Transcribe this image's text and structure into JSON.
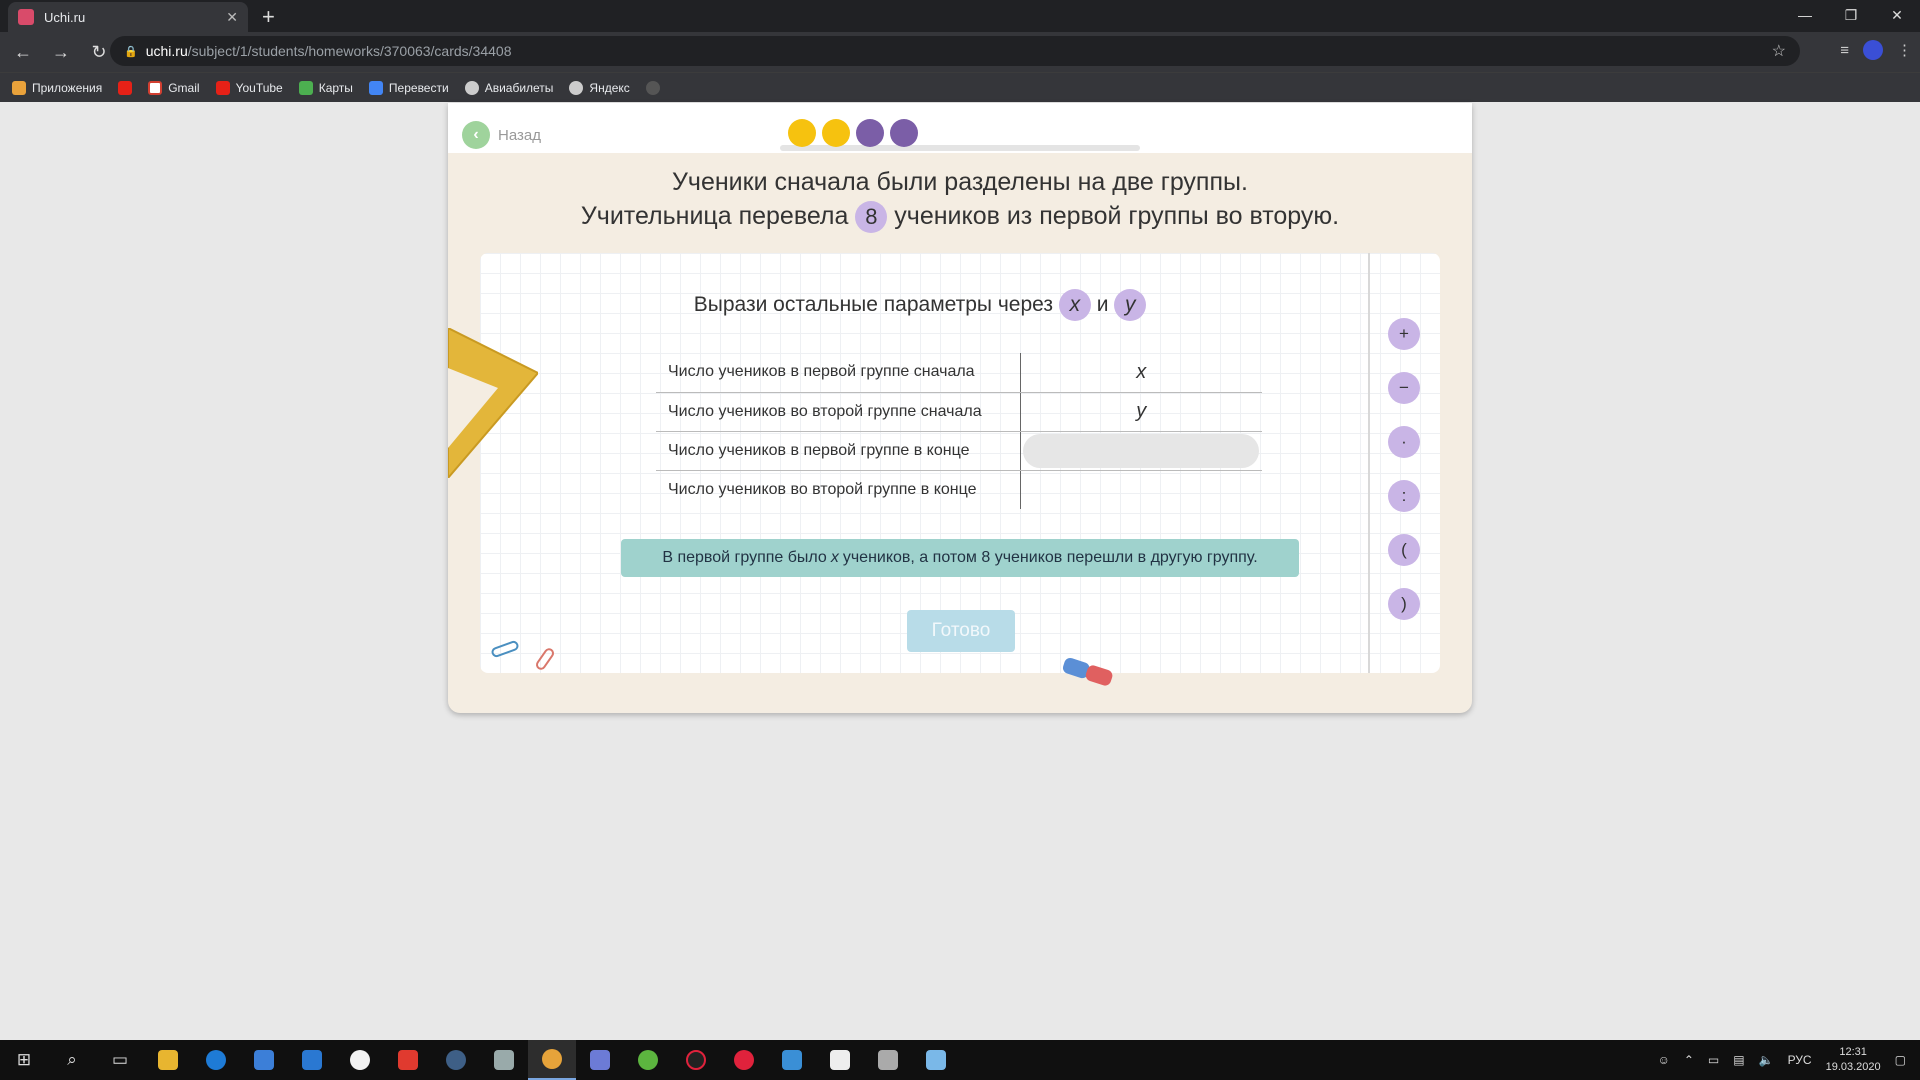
{
  "browser": {
    "tab_title": "Uchi.ru",
    "url_host": "uchi.ru",
    "url_path": "/subject/1/students/homeworks/370063/cards/34408",
    "bookmarks": [
      "Приложения",
      "Gmail",
      "YouTube",
      "Карты",
      "Перевести",
      "Авиабилеты",
      "Яндекс"
    ]
  },
  "card": {
    "back_label": "Назад",
    "progress_dot_colors": [
      "#f6c20f",
      "#f6c20f",
      "#7b5ea7",
      "#7b5ea7"
    ],
    "task_line1": "Ученики сначала были разделены на две группы.",
    "task_line2_before": "Учительница перевела",
    "task_number": "8",
    "task_line2_after": "учеников из первой группы во вторую.",
    "subtitle_text": "Вырази остальные параметры через",
    "var_x": "x",
    "var_and": "и",
    "var_y": "y",
    "rows": [
      {
        "label": "Число учеников в первой группе сначала",
        "value": "x"
      },
      {
        "label": "Число учеников во второй группе сначала",
        "value": "y"
      },
      {
        "label": "Число учеников в первой группе в конце",
        "value": ""
      },
      {
        "label": "Число учеников во второй группе в конце",
        "value": ""
      }
    ],
    "hint_before": "В первой группе было",
    "hint_var": "x",
    "hint_after": "учеников, а потом 8 учеников перешли в другую группу.",
    "done_label": "Готово",
    "operators": [
      "+",
      "−",
      "·",
      ":",
      "(",
      ")"
    ]
  },
  "taskbar": {
    "language": "РУС",
    "time": "12:31",
    "date": "19.03.2020"
  }
}
